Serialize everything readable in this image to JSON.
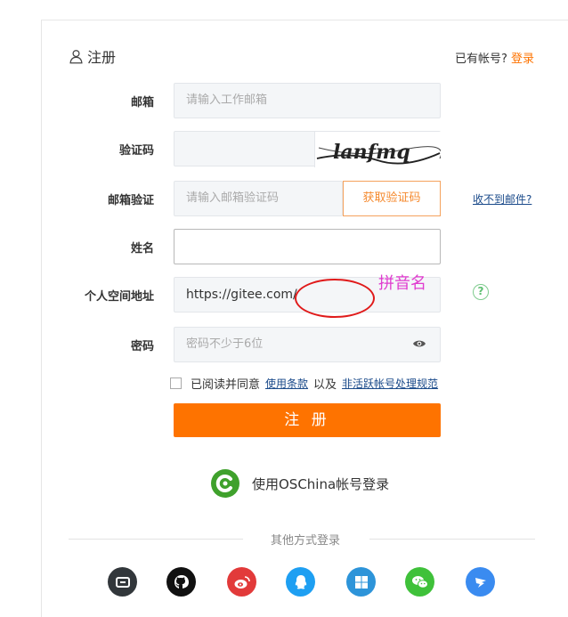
{
  "header": {
    "title": "注册",
    "have_account": "已有帐号?",
    "login_link": "登录"
  },
  "form": {
    "email": {
      "label": "邮箱",
      "placeholder": "请输入工作邮箱"
    },
    "captcha": {
      "label": "验证码",
      "image_text": "lanfmq"
    },
    "email_verify": {
      "label": "邮箱验证",
      "placeholder": "请输入邮箱验证码",
      "get_code": "获取验证码",
      "not_received": "收不到邮件?"
    },
    "name": {
      "label": "姓名",
      "value": ""
    },
    "space": {
      "label": "个人空间地址",
      "prefix": "https://gitee.com/",
      "annotation": "拼音名"
    },
    "password": {
      "label": "密码",
      "placeholder": "密码不少于6位"
    },
    "agree": {
      "text": "已阅读并同意",
      "terms": "使用条款",
      "and": "以及",
      "policy": "非活跃帐号处理规范"
    },
    "submit": "注 册"
  },
  "oschina": {
    "text": "使用OSChina帐号登录"
  },
  "other_login": {
    "label": "其他方式登录"
  },
  "colors": {
    "accent": "#fe7300",
    "link": "#1a4a8a",
    "annotation": "#e03ccf"
  },
  "social_icons": [
    "alipay-icon",
    "github-icon",
    "weibo-icon",
    "qq-icon",
    "windows-icon",
    "wechat-icon",
    "dingtalk-icon"
  ]
}
